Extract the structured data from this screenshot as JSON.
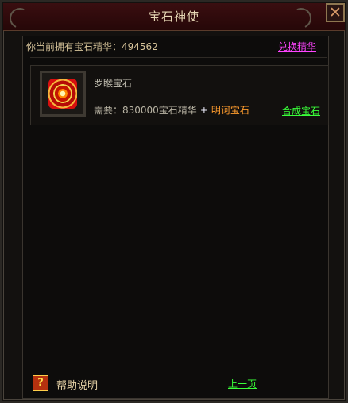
{
  "window": {
    "title": "宝石神使",
    "close_symbol": "✕"
  },
  "summary": {
    "essence_label": "你当前拥有宝石精华：494562",
    "exchange_link": "兑换精华"
  },
  "gems": [
    {
      "name": "罗睺宝石",
      "requirement_prefix": "需要：830000宝石精华",
      "plus_symbol": "+",
      "required_gem": "明诃宝石",
      "action_link": "合成宝石",
      "icon_name": "gem-icon"
    }
  ],
  "footer": {
    "help_icon_symbol": "?",
    "help_text": "帮助说明",
    "prev_page": "上一页"
  },
  "colors": {
    "title_bar": "#3a0e10",
    "link_magenta": "#ff44ff",
    "link_green": "#39ff39",
    "highlight_orange": "#ff9c2d"
  }
}
